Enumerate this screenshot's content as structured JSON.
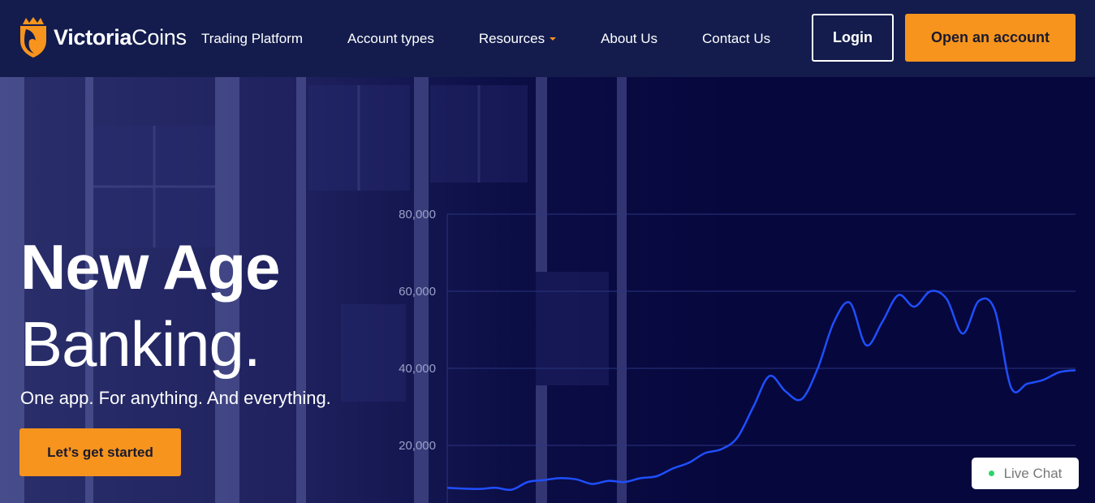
{
  "colors": {
    "nav_bg": "#131c4d",
    "accent": "#f7941d",
    "hero_bg": "#06073d",
    "line": "#1f4fff"
  },
  "brand": {
    "name_bold": "Victoria",
    "name_regular": "Coins",
    "icon": "crown-shield-icon"
  },
  "nav": {
    "items": [
      {
        "label": "Trading Platform"
      },
      {
        "label": "Account types"
      },
      {
        "label": "Resources",
        "has_dropdown": true
      },
      {
        "label": "About Us"
      },
      {
        "label": "Contact Us"
      }
    ],
    "login_label": "Login",
    "open_account_label": "Open an account"
  },
  "hero": {
    "headline_bold": "New Age",
    "headline_regular": "Banking.",
    "tagline": "One app. For anything. And everything.",
    "cta_label": "Let’s get started"
  },
  "chart_data": {
    "type": "line",
    "title": "",
    "xlabel": "",
    "ylabel": "",
    "ylim": [
      0,
      80000
    ],
    "yticks": [
      "20,000",
      "40,000",
      "60,000",
      "80,000"
    ],
    "grid": true,
    "series": [
      {
        "values": [
          9000,
          8800,
          8700,
          9000,
          8500,
          10500,
          11000,
          11500,
          11200,
          10000,
          10800,
          10500,
          11500,
          12000,
          14000,
          15500,
          18000,
          19000,
          22000,
          30000,
          38000,
          34000,
          32000,
          40000,
          52000,
          57000,
          46000,
          52000,
          59000,
          56000,
          60000,
          58000,
          49000,
          57500,
          55000,
          35000,
          36000,
          37000,
          39000,
          39500
        ]
      }
    ]
  },
  "livechat": {
    "label": "Live Chat",
    "status_color": "#2bd46a"
  }
}
